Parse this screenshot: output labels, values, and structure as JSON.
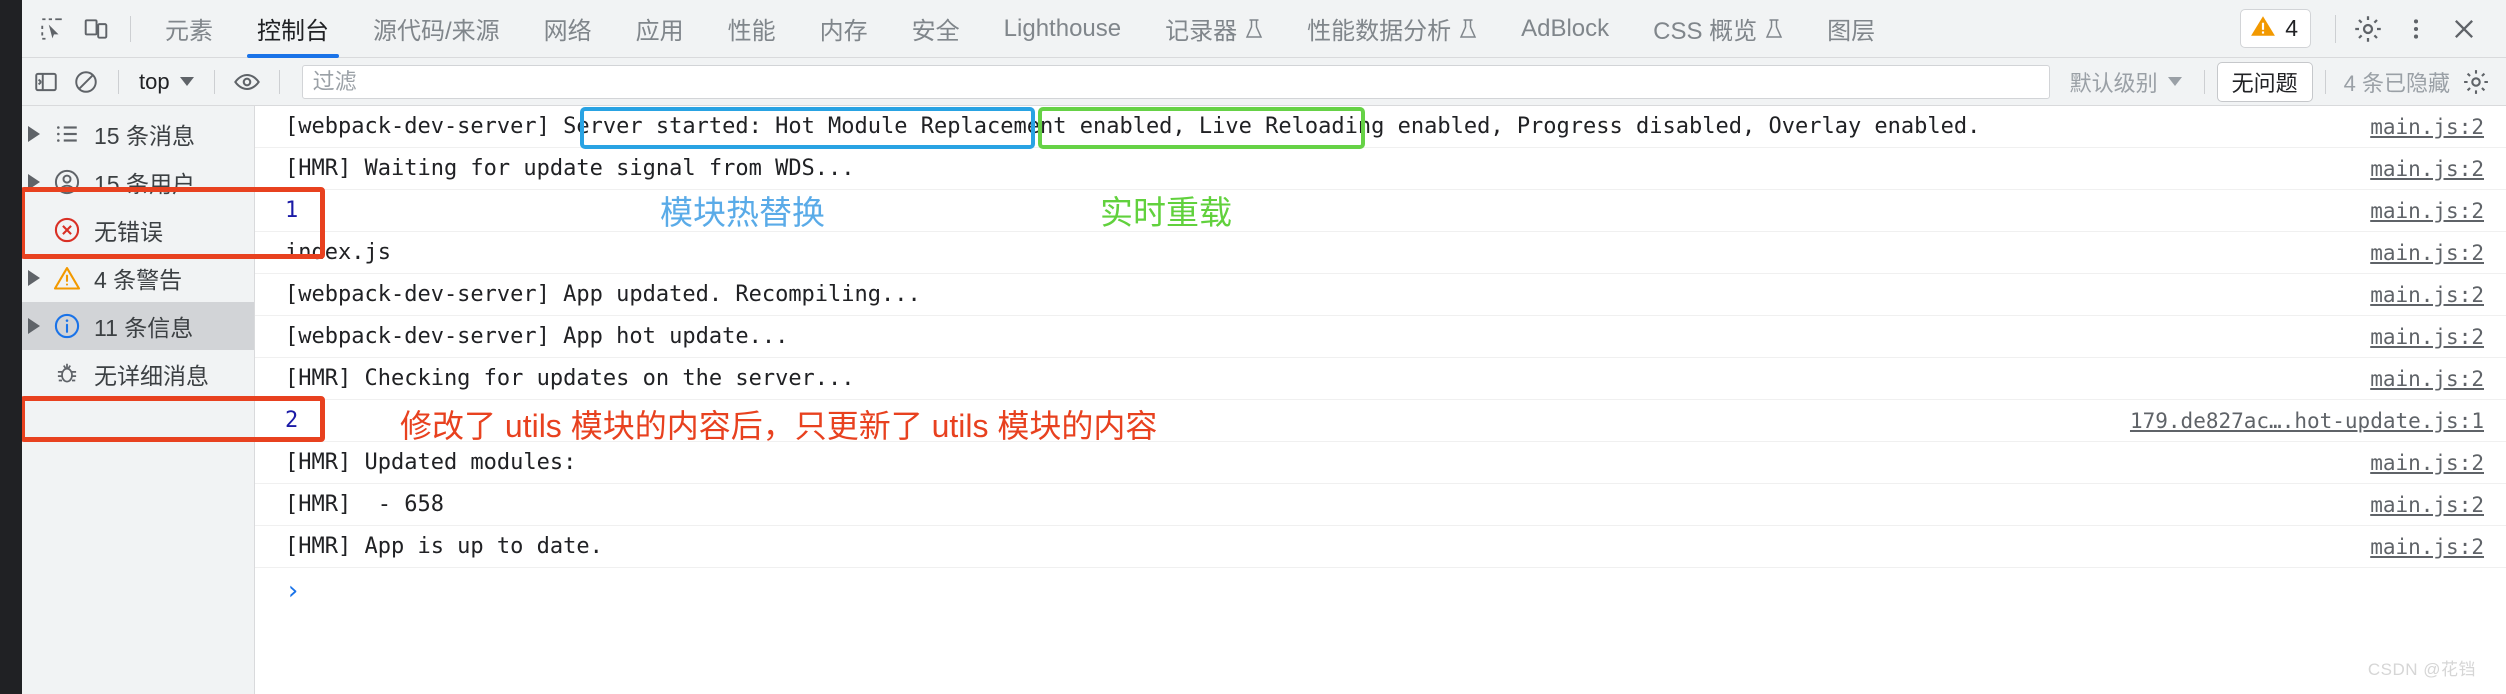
{
  "devtools": {
    "tabs": [
      {
        "label": "元素",
        "active": false,
        "flask": false
      },
      {
        "label": "控制台",
        "active": true,
        "flask": false
      },
      {
        "label": "源代码/来源",
        "active": false,
        "flask": false
      },
      {
        "label": "网络",
        "active": false,
        "flask": false
      },
      {
        "label": "应用",
        "active": false,
        "flask": false
      },
      {
        "label": "性能",
        "active": false,
        "flask": false
      },
      {
        "label": "内存",
        "active": false,
        "flask": false
      },
      {
        "label": "安全",
        "active": false,
        "flask": false
      },
      {
        "label": "Lighthouse",
        "active": false,
        "flask": false
      },
      {
        "label": "记录器",
        "active": false,
        "flask": true
      },
      {
        "label": "性能数据分析",
        "active": false,
        "flask": true
      },
      {
        "label": "AdBlock",
        "active": false,
        "flask": false
      },
      {
        "label": "CSS 概览",
        "active": false,
        "flask": true
      },
      {
        "label": "图层",
        "active": false,
        "flask": false
      }
    ],
    "warning_badge": {
      "count": "4",
      "icon": "warning-triangle-icon"
    },
    "icons": {
      "inspect": "inspect-element-icon",
      "device": "device-toolbar-icon",
      "settings": "gear-icon",
      "more": "more-vertical-icon",
      "close": "close-icon"
    }
  },
  "filterbar": {
    "sidebar_toggle_icon": "show-console-sidebar-icon",
    "clear_icon": "clear-console-icon",
    "context": "top",
    "eye_icon": "live-expression-icon",
    "filter_placeholder": "过滤",
    "filter_value": "",
    "level": "默认级别",
    "issues_label": "无问题",
    "hidden_label": "4 条已隐藏",
    "settings_icon": "gear-icon"
  },
  "sidebar": {
    "items": [
      {
        "label": "15 条消息",
        "icon": "list-icon",
        "expandable": true,
        "selected": false
      },
      {
        "label": "15 条用户…",
        "icon": "user-icon",
        "expandable": true,
        "selected": false
      },
      {
        "label": "无错误",
        "icon": "error-icon",
        "expandable": false,
        "selected": false
      },
      {
        "label": "4 条警告",
        "icon": "warning-icon",
        "expandable": true,
        "selected": false
      },
      {
        "label": "11 条信息",
        "icon": "info-icon",
        "expandable": true,
        "selected": true
      },
      {
        "label": "无详细消息",
        "icon": "bug-icon",
        "expandable": false,
        "selected": false
      }
    ]
  },
  "console": {
    "rows": [
      {
        "id": "row-0",
        "segments": [
          {
            "text": "[webpack-dev-server] Server started: ",
            "style": "plain"
          },
          {
            "text": "Hot Module Replacement enabled, ",
            "style": "boxed-blue"
          },
          {
            "text": "Live Reloading enabled, ",
            "style": "boxed-green"
          },
          {
            "text": "Progress disabled, Overlay enabled.",
            "style": "plain"
          }
        ],
        "source": "main.js:2"
      },
      {
        "id": "row-1",
        "segments": [
          {
            "text": "[HMR] Waiting for update signal from WDS...",
            "style": "plain"
          }
        ],
        "source": "main.js:2"
      },
      {
        "id": "row-2",
        "segments": [
          {
            "text": "1",
            "style": "number"
          }
        ],
        "source": "main.js:2"
      },
      {
        "id": "row-3",
        "segments": [
          {
            "text": "index.js",
            "style": "plain"
          }
        ],
        "source": "main.js:2"
      },
      {
        "id": "row-4",
        "segments": [
          {
            "text": "[webpack-dev-server] App updated. Recompiling...",
            "style": "plain"
          }
        ],
        "source": "main.js:2"
      },
      {
        "id": "row-5",
        "segments": [
          {
            "text": "[webpack-dev-server] App hot update...",
            "style": "plain"
          }
        ],
        "source": "main.js:2"
      },
      {
        "id": "row-6",
        "segments": [
          {
            "text": "[HMR] Checking for updates on the server...",
            "style": "plain"
          }
        ],
        "source": "main.js:2"
      },
      {
        "id": "row-7",
        "segments": [
          {
            "text": "2",
            "style": "number"
          }
        ],
        "source": "179.de827ac….hot-update.js:1"
      },
      {
        "id": "row-8",
        "segments": [
          {
            "text": "[HMR] Updated modules:",
            "style": "plain"
          }
        ],
        "source": "main.js:2"
      },
      {
        "id": "row-9",
        "segments": [
          {
            "text": "[HMR]  - 658",
            "style": "plain"
          }
        ],
        "source": "main.js:2"
      },
      {
        "id": "row-10",
        "segments": [
          {
            "text": "[HMR] App is up to date.",
            "style": "plain"
          }
        ],
        "source": "main.js:2"
      }
    ],
    "prompt": "›"
  },
  "annotations": {
    "hmr_label": "模块热替换",
    "live_reload_label": "实时重载",
    "utils_note": "修改了 utils 模块的内容后，只更新了 utils 模块的内容",
    "colors": {
      "blue": "#29a3e3",
      "green": "#66d246",
      "red": "#e8411f"
    }
  },
  "watermark": "CSDN @花铛"
}
